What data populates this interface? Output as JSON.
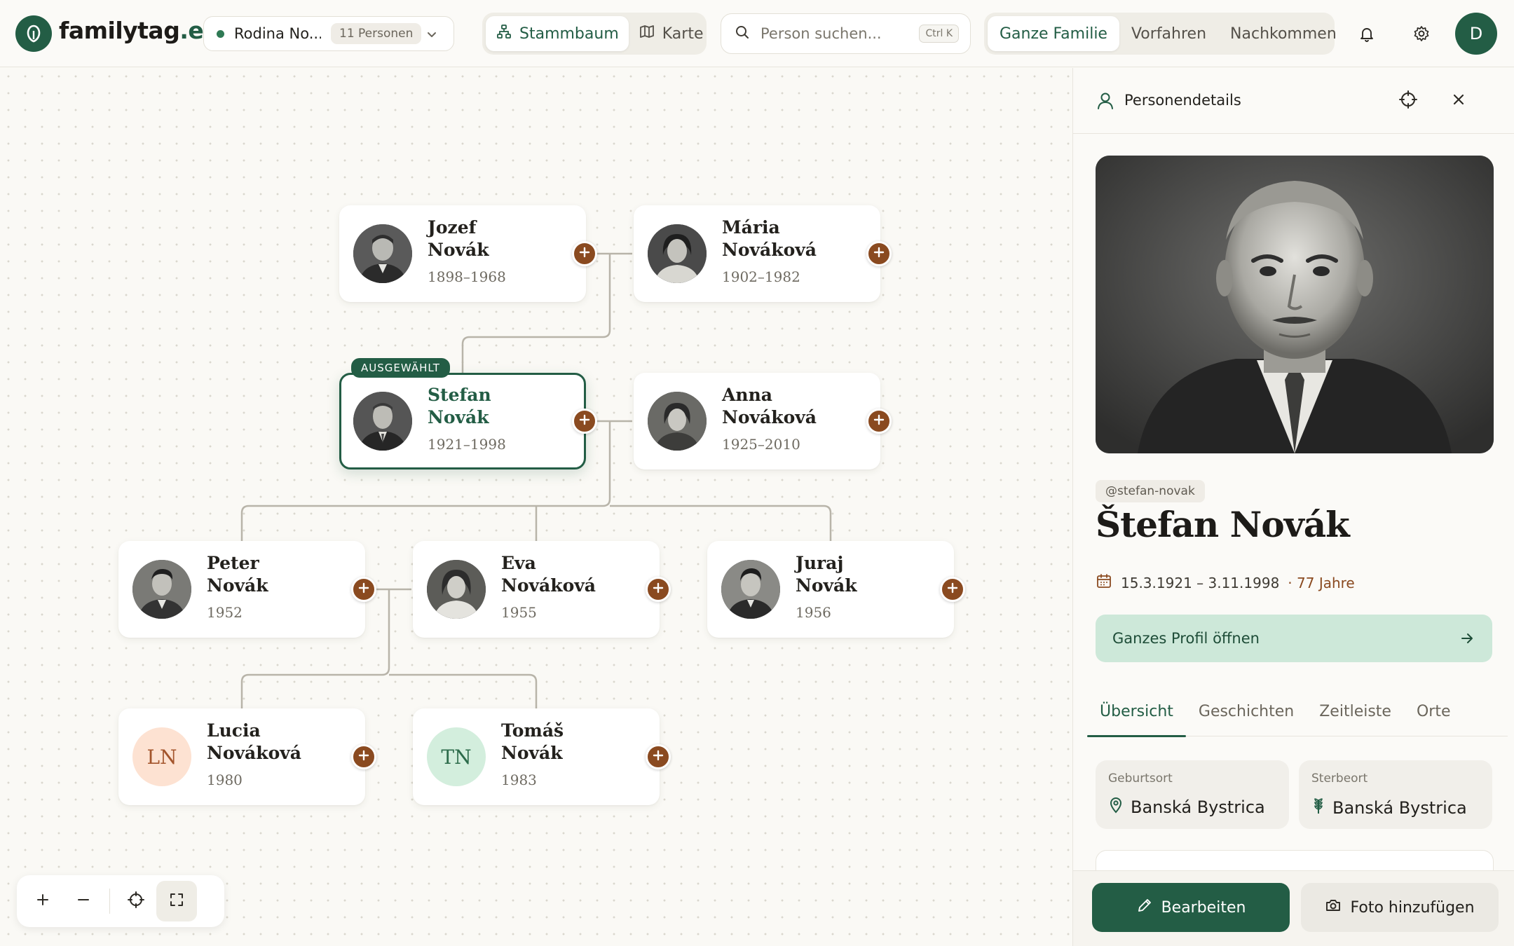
{
  "app": {
    "name": "familytag",
    "tld": ".eu",
    "accent": "#235d45",
    "add_color": "#8a4a20"
  },
  "family_select": {
    "name": "Rodina No...",
    "count": "11 Personen"
  },
  "view_toggle": {
    "tree": "Stammbaum",
    "map": "Karte"
  },
  "search": {
    "placeholder": "Person suchen...",
    "shortcut": "Ctrl K"
  },
  "scope": {
    "whole": "Ganze Familie",
    "ancestors": "Vorfahren",
    "descendants": "Nachkommen"
  },
  "user": {
    "initial": "D"
  },
  "tree": {
    "selected_badge": "AUSGEWÄHLT",
    "people": {
      "jozef": {
        "first": "Jozef",
        "last": "Novák",
        "dates": "1898–1968"
      },
      "maria": {
        "first": "Mária",
        "last": "Nováková",
        "dates": "1902–1982"
      },
      "stefan": {
        "first": "Stefan",
        "last": "Novák",
        "dates": "1921–1998"
      },
      "anna": {
        "first": "Anna",
        "last": "Nováková",
        "dates": "1925–2010"
      },
      "peter": {
        "first": "Peter",
        "last": "Novák",
        "dates": "1952"
      },
      "eva": {
        "first": "Eva",
        "last": "Nováková",
        "dates": "1955"
      },
      "juraj": {
        "first": "Juraj",
        "last": "Novák",
        "dates": "1956"
      },
      "lucia": {
        "first": "Lucia",
        "last": "Nováková",
        "dates": "1980",
        "initials": "LN"
      },
      "tomas": {
        "first": "Tomáš",
        "last": "Novák",
        "dates": "1983",
        "initials": "TN"
      }
    }
  },
  "panel": {
    "title": "Personendetails",
    "handle": "@stefan-novak",
    "name": "Štefan Novák",
    "lifespan": "15.3.1921 – 3.11.1998",
    "age": "· 77 Jahre",
    "open_profile": "Ganzes Profil öffnen",
    "tabs": [
      "Übersicht",
      "Geschichten",
      "Zeitleiste",
      "Orte"
    ],
    "birth_label": "Geburtsort",
    "birth_place": "Banská Bystrica",
    "death_label": "Sterbeort",
    "death_place": "Banská Bystrica",
    "edit": "Bearbeiten",
    "add_photo": "Foto hinzufügen"
  }
}
